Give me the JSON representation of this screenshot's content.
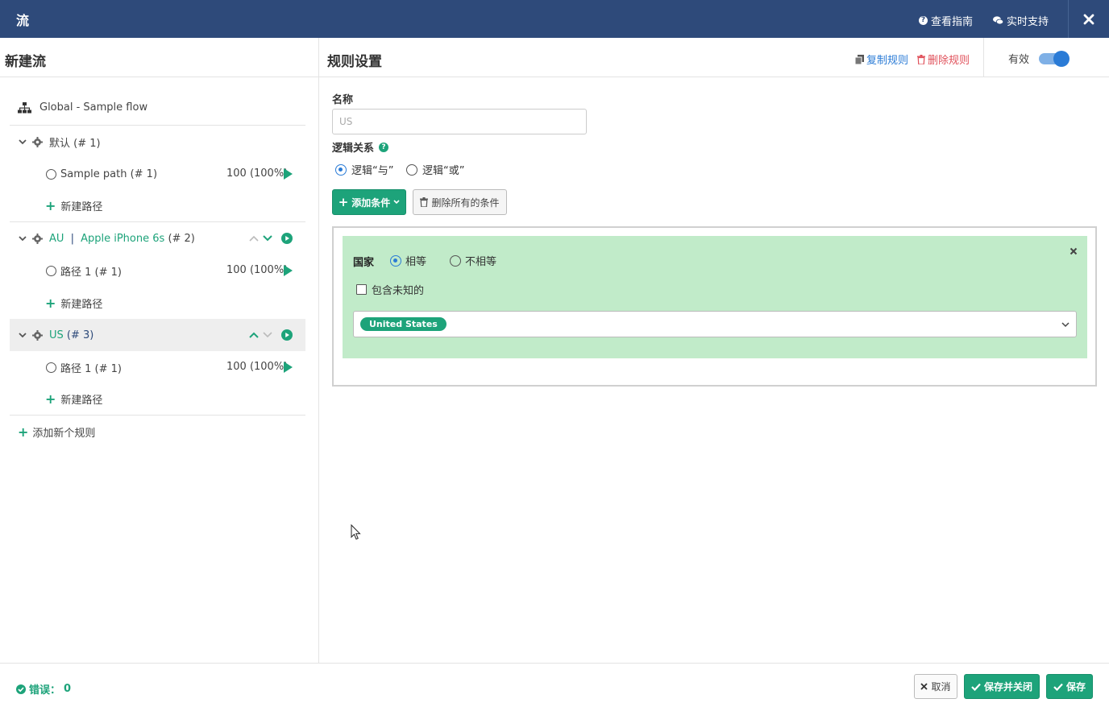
{
  "topbar": {
    "title": "流",
    "guide_label": "查看指南",
    "support_label": "实时支持"
  },
  "left": {
    "title": "新建流",
    "flow_name": "Global - Sample flow",
    "rules": [
      {
        "name": "默认",
        "index": "(# 1)",
        "paths": [
          {
            "name": "Sample path",
            "index": "(# 1)",
            "value": "100 (100%)"
          }
        ],
        "new_path_label": "新建路径"
      },
      {
        "name_a": "AU",
        "divider": "|",
        "name_b": "Apple iPhone 6s",
        "index": "(# 2)",
        "paths": [
          {
            "name": "路径 1",
            "index": "(# 1)",
            "value": "100 (100%)"
          }
        ],
        "new_path_label": "新建路径"
      },
      {
        "name": "US",
        "index": "(# 3)",
        "paths": [
          {
            "name": "路径 1",
            "index": "(# 1)",
            "value": "100 (100%)"
          }
        ],
        "new_path_label": "新建路径"
      }
    ],
    "add_rule_label": "添加新个规则"
  },
  "right": {
    "title": "规则设置",
    "copy_rule_label": "复制规则",
    "delete_rule_label": "删除规则",
    "active_label": "有效",
    "active_on": true,
    "name_label": "名称",
    "name_placeholder": "US",
    "logic_label": "逻辑关系",
    "logic_and_label": "逻辑“与”",
    "logic_or_label": "逻辑“或”",
    "logic_selected": "and",
    "add_condition_label": "添加条件",
    "delete_all_label": "删除所有的条件",
    "condition": {
      "field_label": "国家",
      "equal_label": "相等",
      "not_equal_label": "不相等",
      "selected": "equal",
      "include_unknown_label": "包含未知的",
      "include_unknown_checked": false,
      "tags": [
        "United States"
      ]
    }
  },
  "footer": {
    "error_label": "错误：",
    "error_count": "0",
    "cancel_label": "取消",
    "save_close_label": "保存并关闭",
    "save_label": "保存"
  },
  "colors": {
    "header_bg": "#2e4a7a",
    "accent_green": "#1da37a",
    "condition_bg": "#c1ebc9",
    "link_blue": "#2a7bd6",
    "danger_red": "#e0505a"
  }
}
